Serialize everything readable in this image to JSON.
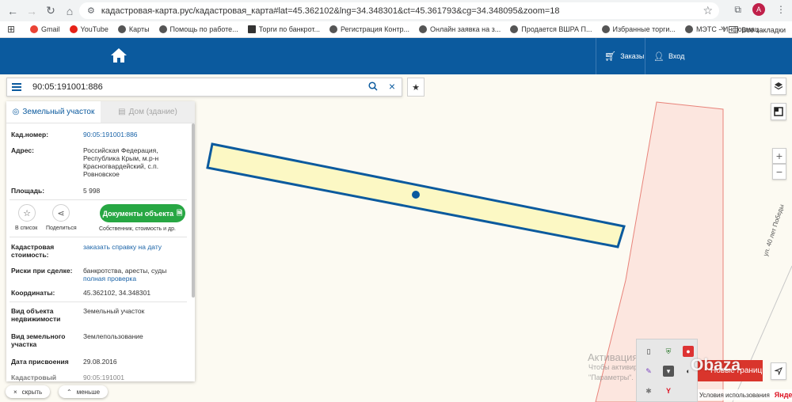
{
  "browser": {
    "url": "кадастровая-карта.рус/кадастровая_карта#lat=45.362102&lng=34.348301&ct=45.361793&cg=34.348095&zoom=18",
    "avatar_letter": "A",
    "bookmarks": [
      "Gmail",
      "YouTube",
      "Карты",
      "Помощь по работе...",
      "Торги по банкрот...",
      "Регистрация Контр...",
      "Онлайн заявка на з...",
      "Продается ВШРА П...",
      "Избранные торги...",
      "МЭТС - Информац..."
    ],
    "all_bookmarks": "Все закладки"
  },
  "header": {
    "orders": "Заказы",
    "login": "Вход"
  },
  "search": {
    "query": "90:05:191001:886"
  },
  "panel": {
    "tabs": [
      {
        "label": "Земельный участок"
      },
      {
        "label": "Дом (здание)"
      }
    ],
    "cad_number_label": "Кад.номер:",
    "cad_number": "90:05:191001:886",
    "address_label": "Адрес:",
    "address": "Российская Федерация, Республика Крым, м.р-н Красногвардейский, с.п. Ровновское",
    "area_label": "Площадь:",
    "area": "5 998",
    "favorite": "В список",
    "share": "Поделиться",
    "docs_button": "Документы объекта",
    "docs_sub": "Собственник, стоимость и др.",
    "cost_label": "Кадастровая стоимость:",
    "cost_link": "заказать справку на дату",
    "risks_label": "Риски при сделке:",
    "risks_value": "банкротства, аресты, суды",
    "risks_link": "полная проверка",
    "coords_label": "Координаты:",
    "coords": "45.362102, 34.348301",
    "type_label": "Вид объекта недвижимости",
    "type_value": "Земельный участок",
    "use_label": "Вид земельного участка",
    "use_value": "Землепользование",
    "date_label": "Дата присвоения",
    "date_value": "29.08.2016",
    "extra_label": "Кадастровый",
    "extra_value": "90:05:191001"
  },
  "bottom": {
    "hide": "скрыть",
    "less": "меньше"
  },
  "map": {
    "street": "ул. 40 лет Победы",
    "watermark_title": "Активация Windows",
    "watermark_line2": "Чтобы активировать Windows, перейдите в раздел",
    "watermark_line3": "\"Параметры\".",
    "red_button": "Новые границы",
    "overlay_logo": "Obaza",
    "terms": "Условия использования",
    "yandex": "Яндекс"
  },
  "colors": {
    "header": "#0b5a9e",
    "parcel_fill": "#fcf8c4",
    "parcel_stroke": "#0b5a9e",
    "neighbor_fill": "#fce6df",
    "neighbor_stroke": "#e8837a",
    "docs_button": "#27a743"
  }
}
